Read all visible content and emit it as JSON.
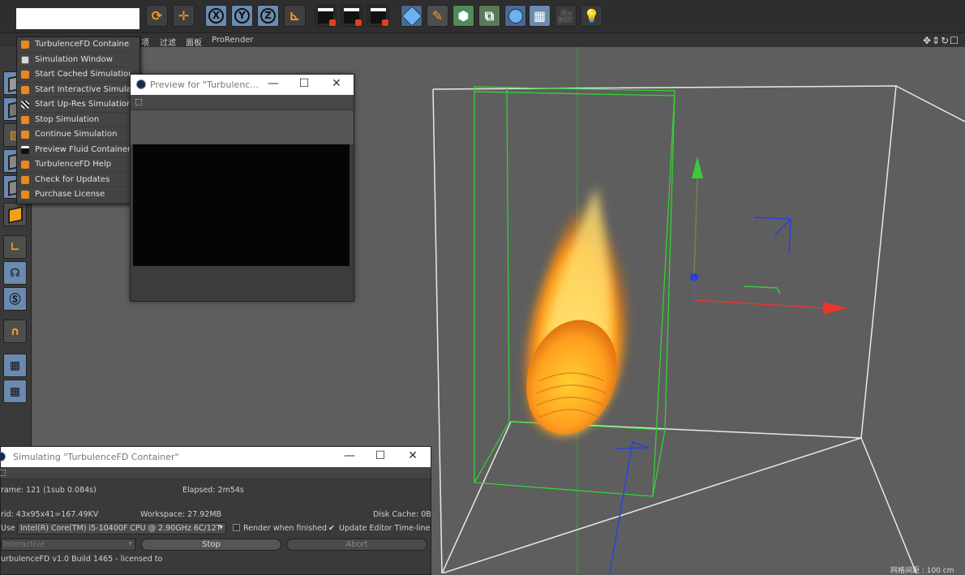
{
  "menubar": {
    "items": [
      "项",
      "过滤",
      "面板",
      "ProRender"
    ]
  },
  "dropdown": {
    "items": [
      {
        "label": "TurbulenceFD Container",
        "icon": "fluid-container-icon"
      },
      {
        "label": "Simulation Window",
        "icon": "window-icon"
      },
      {
        "label": "Start Cached Simulation",
        "icon": "fluid-icon"
      },
      {
        "label": "Start Interactive Simulation",
        "icon": "fluid-icon"
      },
      {
        "label": "Start Up-Res Simulation",
        "icon": "checker-icon"
      },
      {
        "label": "Stop Simulation",
        "icon": "fluid-icon"
      },
      {
        "label": "Continue Simulation",
        "icon": "fluid-icon"
      },
      {
        "label": "Preview Fluid Container",
        "icon": "clapper-icon"
      },
      {
        "label": "TurbulenceFD Help",
        "icon": "fluid-icon"
      },
      {
        "label": "Check for Updates",
        "icon": "fluid-icon"
      },
      {
        "label": "Purchase License",
        "icon": "fluid-icon"
      }
    ]
  },
  "preview_window": {
    "title": "Preview for \"Turbulenc...",
    "minimize": "—",
    "maximize": "☐",
    "close": "✕"
  },
  "sim_window": {
    "title": "Simulating \"TurbulenceFD Container\"",
    "minimize": "—",
    "maximize": "☐",
    "close": "✕",
    "frame": "rame: 121 (1sub 0.084s)",
    "elapsed": "Elapsed: 2m54s",
    "grid": "rid: 43x95x41=167.49KV",
    "workspace": "Workspace: 27.92MB",
    "disk_cache": "Disk Cache: 0B",
    "use_label": "Use",
    "cpu": "Intel(R) Core(TM) i5-10400F CPU @ 2.90GHz 6C/12T",
    "render_when_finished": "Render when finished",
    "update_timeline": "Update Editor Time-line",
    "mode": "Interactive",
    "stop": "Stop",
    "abort": "Abort",
    "footer": "urbulenceFD v1.0 Build 1465 - licensed to"
  },
  "viewport": {
    "status": "网格间距 : 100 cm",
    "nav_icons": "✥⇕↻☐"
  },
  "colors": {
    "axis_x": "#e8352a",
    "axis_y": "#3ec83e",
    "axis_z": "#2a40e0",
    "container": "#31d931",
    "flame": "#ffb020"
  }
}
